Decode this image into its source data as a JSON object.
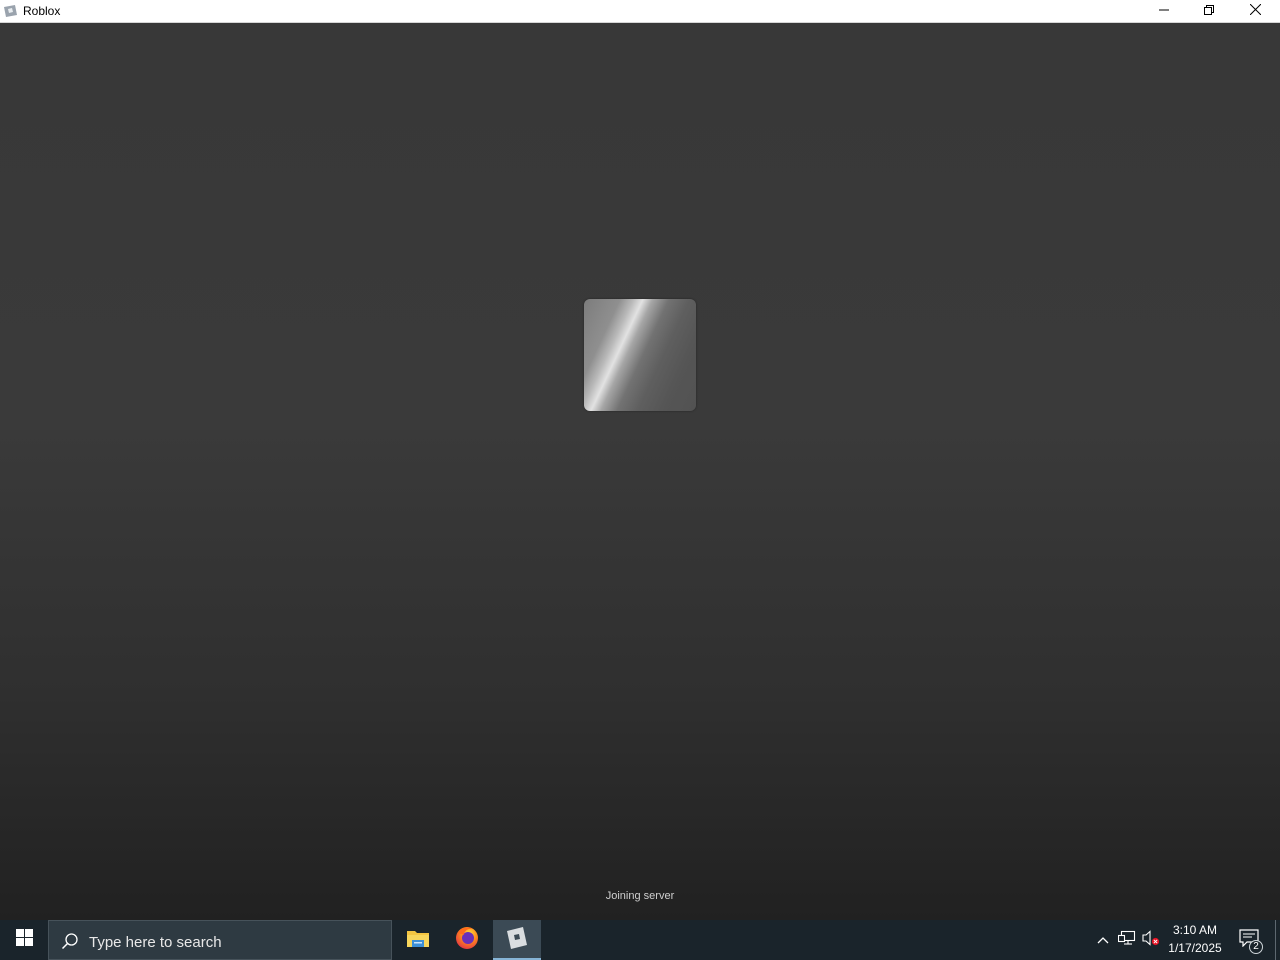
{
  "window": {
    "title": "Roblox",
    "icon": "roblox-icon",
    "controls": [
      "minimize-icon",
      "restore-icon",
      "close-icon"
    ]
  },
  "loading": {
    "status": "Joining server",
    "logo": "roblox-logo-placeholder"
  },
  "taskbar": {
    "start_icon": "windows-icon",
    "search": {
      "placeholder": "Type here to search",
      "icon": "search-icon"
    },
    "pinned_apps": [
      "file-explorer-icon",
      "firefox-icon",
      "roblox-icon"
    ],
    "active_app": "roblox",
    "tray": {
      "icons": [
        "chevron-up-icon",
        "network-icon",
        "volume-muted-icon"
      ],
      "time": "3:10 AM",
      "date": "1/17/2025",
      "notification_count": "2"
    }
  },
  "colors": {
    "taskbar_bg": "#1a242b",
    "active_indicator": "#86b4d6"
  }
}
